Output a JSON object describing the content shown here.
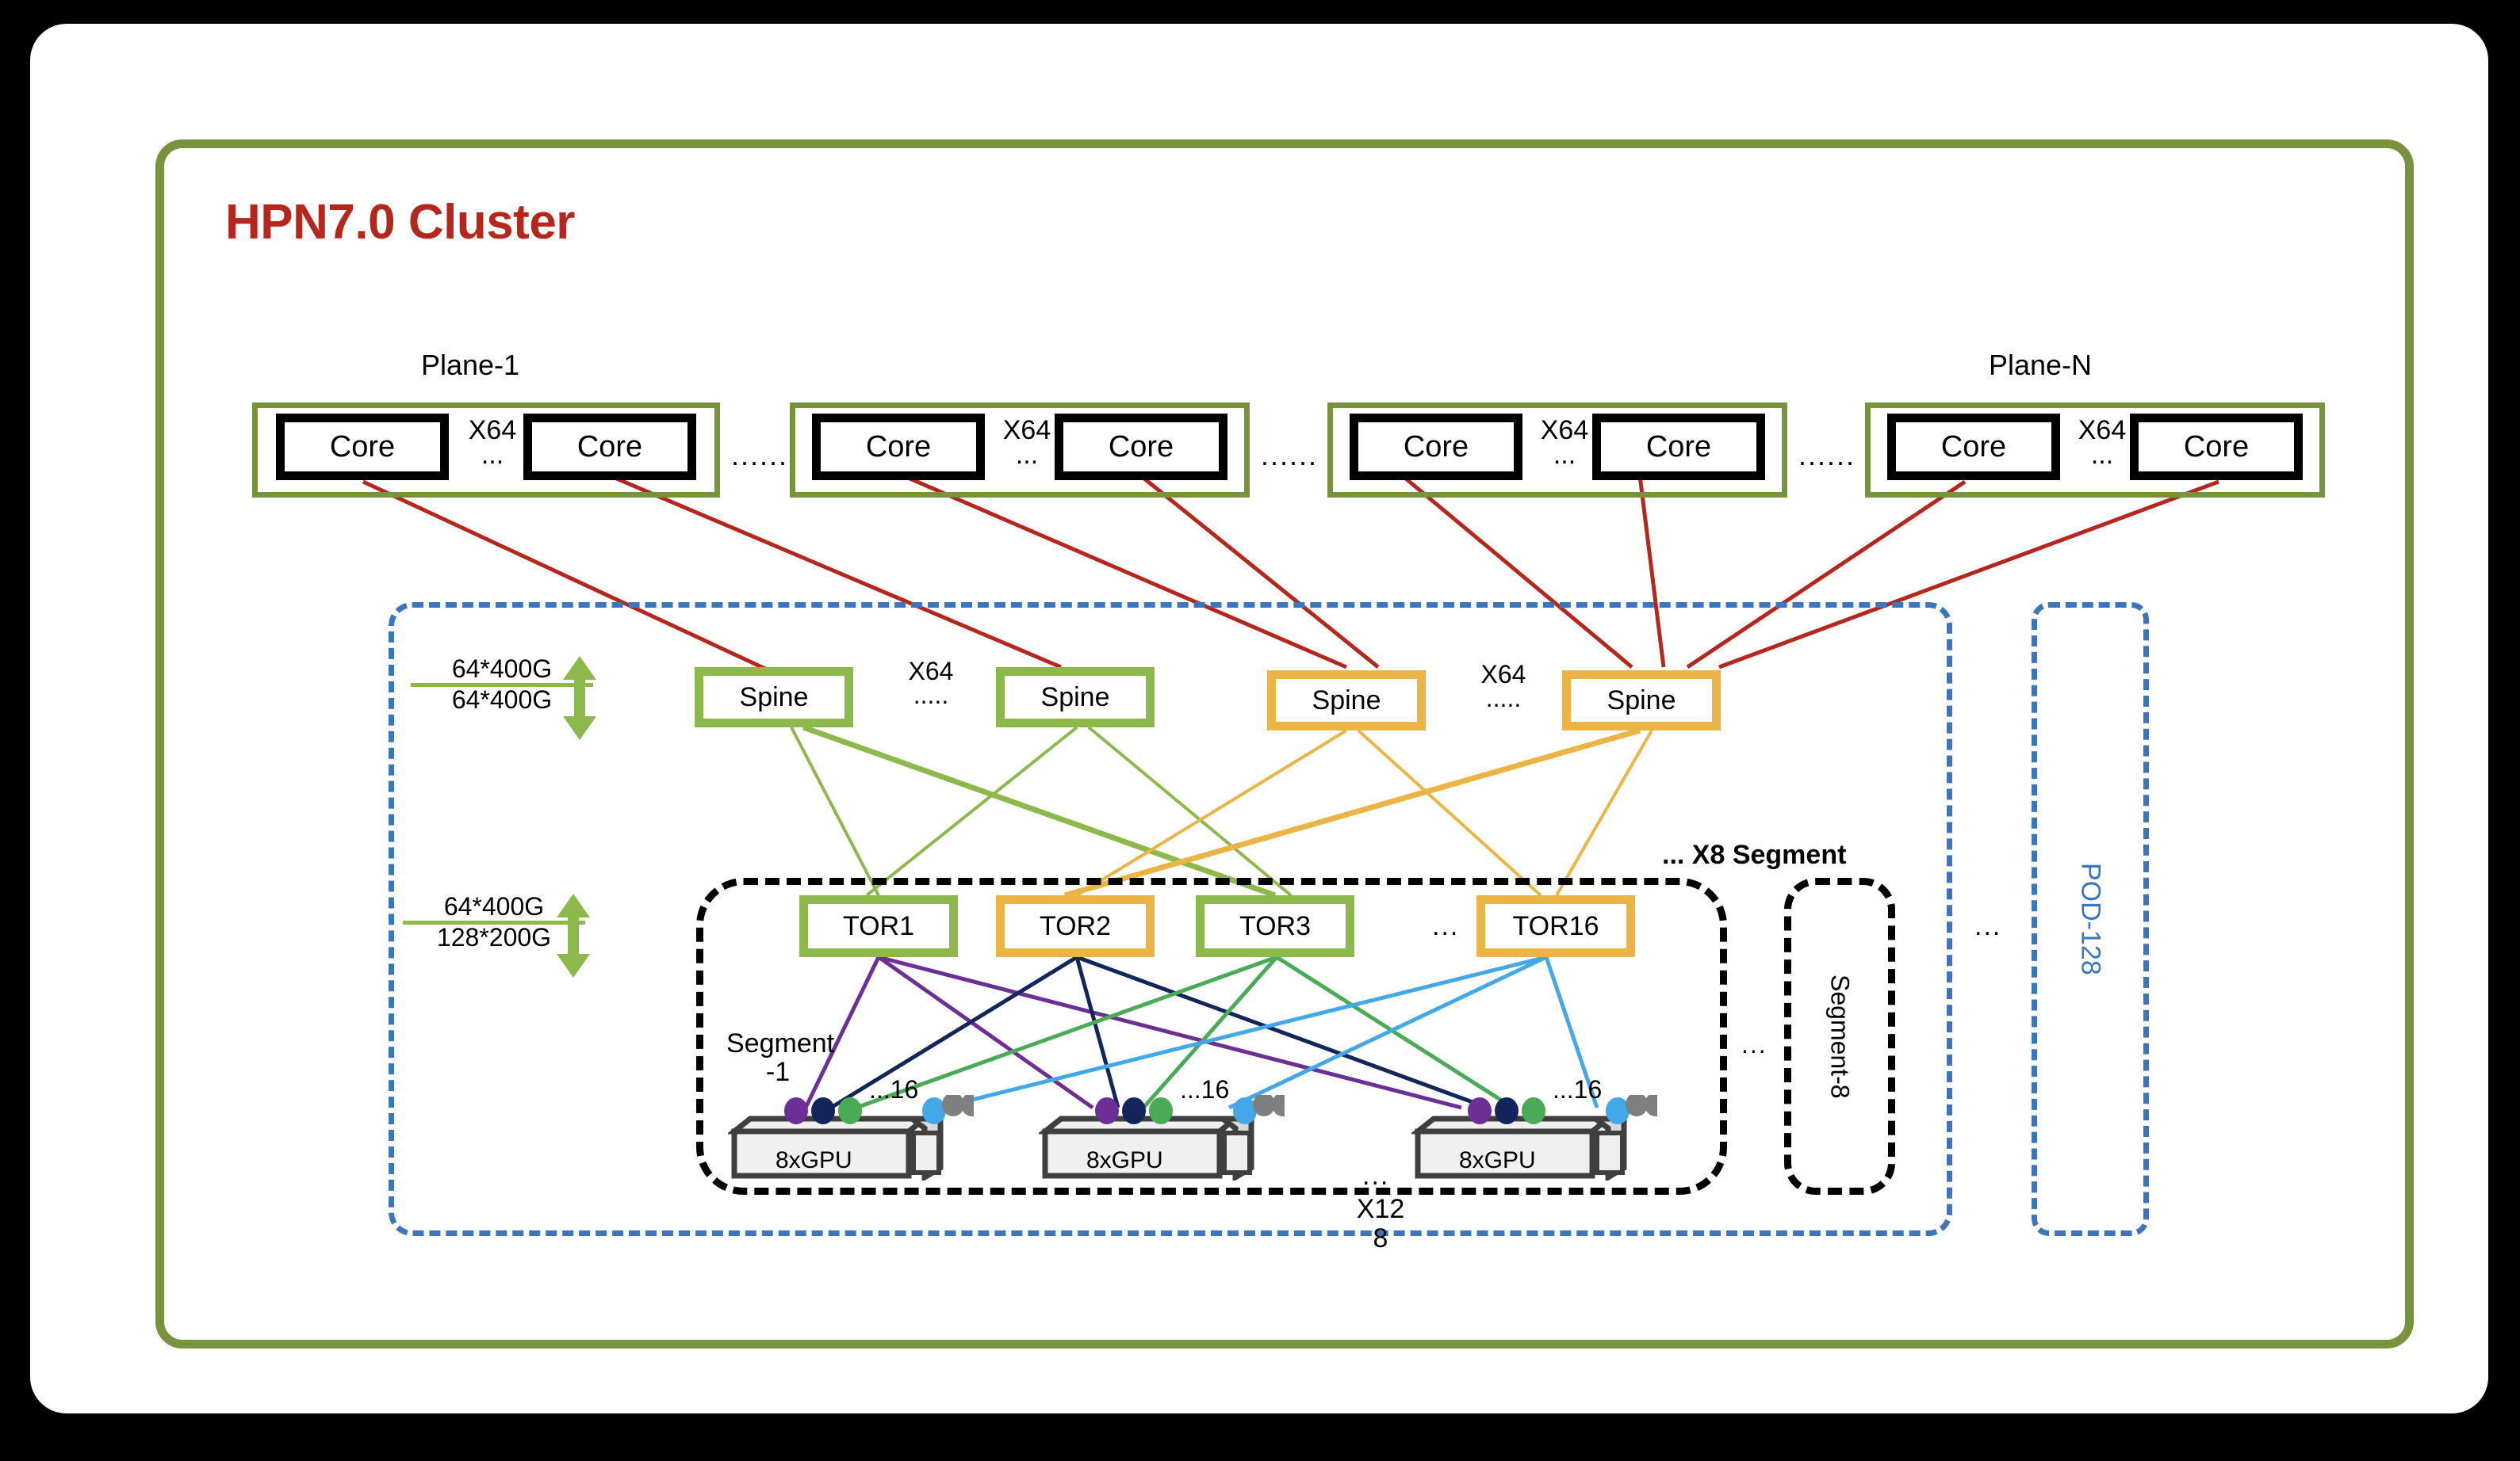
{
  "title": "HPN7.0 Cluster",
  "colors": {
    "title_red": "#b5271c",
    "frame_green": "#77933c",
    "spine_green": "#8cb84c",
    "spine_orange": "#eab544",
    "pod_blue": "#3a75bd",
    "core_link_red": "#b5271c",
    "nic_purple": "#6b2f96",
    "nic_navy": "#12265c",
    "nic_green": "#4aab57",
    "nic_lightblue": "#43a7e8",
    "nic_gray": "#7f7f7f"
  },
  "planes": [
    {
      "label": "Plane-1",
      "core_left": "Core",
      "core_right": "Core",
      "multiplier": "X64",
      "ellipsis": "..."
    },
    {
      "label": "",
      "core_left": "Core",
      "core_right": "Core",
      "multiplier": "X64",
      "ellipsis": "..."
    },
    {
      "label": "",
      "core_left": "Core",
      "core_right": "Core",
      "multiplier": "X64",
      "ellipsis": "..."
    },
    {
      "label": "Plane-N",
      "core_left": "Core",
      "core_right": "Core",
      "multiplier": "X64",
      "ellipsis": "..."
    }
  ],
  "plane_separator": "......",
  "bandwidth": [
    {
      "up": "64*400G",
      "down": "64*400G"
    },
    {
      "up": "64*400G",
      "down": "128*200G"
    }
  ],
  "spines": [
    {
      "label": "Spine",
      "color": "green"
    },
    {
      "label": "Spine",
      "color": "green"
    },
    {
      "label": "Spine",
      "color": "orange"
    },
    {
      "label": "Spine",
      "color": "orange"
    }
  ],
  "spine_group_labels": [
    {
      "multiplier": "X64",
      "ellipsis": "....."
    },
    {
      "multiplier": "X64",
      "ellipsis": "....."
    }
  ],
  "tors": [
    {
      "label": "TOR1",
      "color": "green"
    },
    {
      "label": "TOR2",
      "color": "orange"
    },
    {
      "label": "TOR3",
      "color": "green"
    },
    {
      "label": "TOR16",
      "color": "orange"
    }
  ],
  "tor_ellipsis": "...",
  "gpu_servers": [
    {
      "label": "8xGPU",
      "ports_label": "...16"
    },
    {
      "label": "8xGPU",
      "ports_label": "...16"
    },
    {
      "label": "8xGPU",
      "ports_label": "...16"
    }
  ],
  "gpu_ellipsis": "...",
  "segment_label": "Segment\n-1",
  "segment_label_line1": "Segment",
  "segment_label_line2": "-1",
  "x8_segment_label": "... X8 Segment",
  "segment8_label": "Segment-8",
  "segment_inner_ellipsis": "...",
  "pod_label": "POD-128",
  "pod_ellipsis": "...",
  "x128_label_line1": "X12",
  "x128_label_line2": "8"
}
